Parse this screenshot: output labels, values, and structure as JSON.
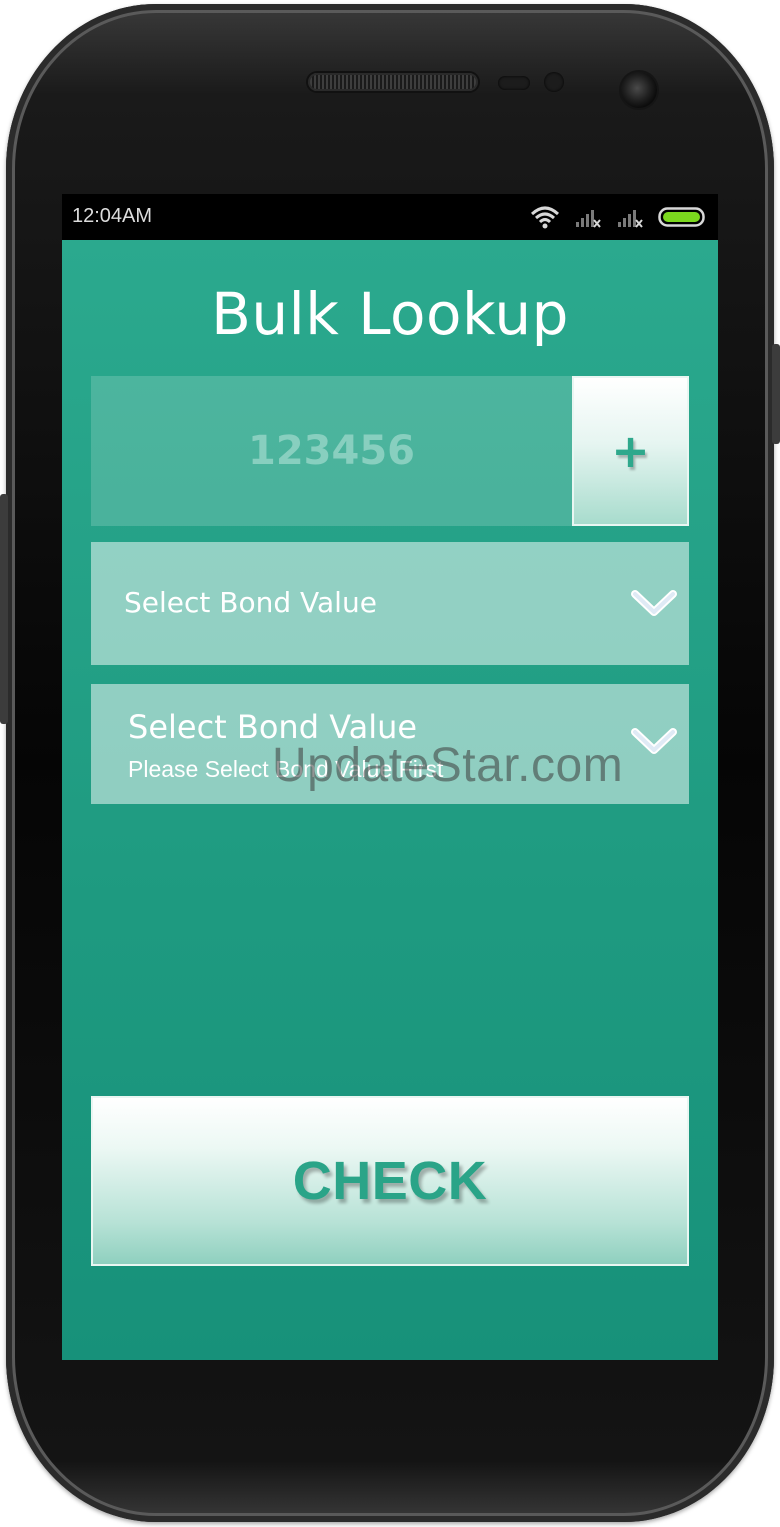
{
  "status_bar": {
    "time": "12:04AM",
    "icons": [
      "wifi-icon",
      "signal-no-service-icon",
      "signal-no-service-icon",
      "battery-full-icon"
    ],
    "battery_color": "#7bd81e"
  },
  "screen": {
    "title": "Bulk Lookup",
    "number_input": {
      "placeholder": "123456",
      "value": ""
    },
    "add_button_label": "+",
    "bond_value_select": {
      "label": "Select Bond Value",
      "icon": "chevron-down-icon"
    },
    "second_select": {
      "label": "Select Bond Value",
      "sublabel": "Please Select Bond Value First",
      "icon": "chevron-down-icon"
    },
    "check_button_label": "CHECK"
  },
  "watermark": "UpdateStar.com",
  "colors": {
    "accent": "#2ba98e",
    "button_text": "#2aa488"
  }
}
